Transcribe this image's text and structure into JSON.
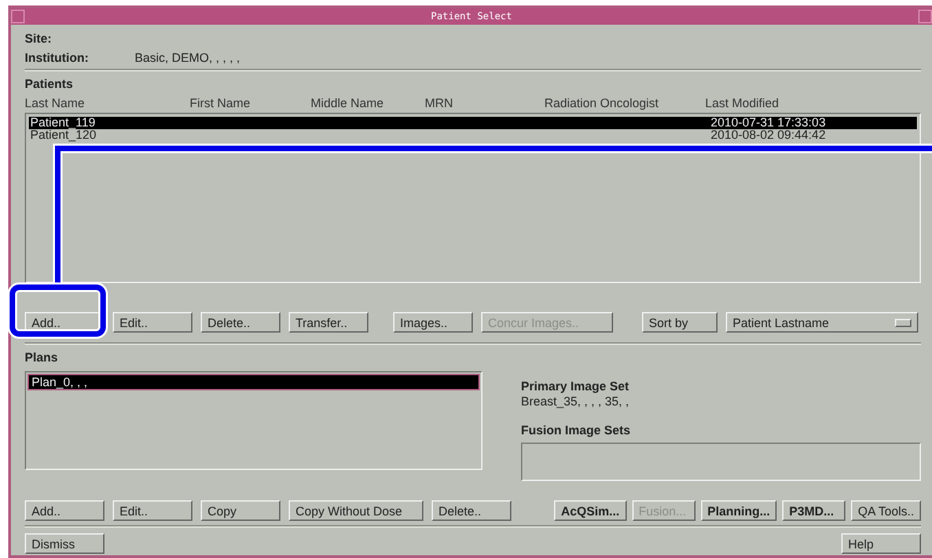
{
  "window": {
    "title": "Patient Select"
  },
  "site": {
    "site_label": "Site:",
    "institution_label": "Institution:",
    "institution_value": "Basic, DEMO, , , , ,"
  },
  "patients": {
    "title": "Patients",
    "columns": [
      "Last Name",
      "First Name",
      "Middle Name",
      "MRN",
      "Radiation Oncologist",
      "Last Modified"
    ],
    "rows": [
      {
        "cells": [
          "Patient_119",
          "",
          "",
          "",
          "",
          "2010-07-31 17:33:03"
        ],
        "selected": true
      },
      {
        "cells": [
          "Patient_120",
          "",
          "",
          "",
          "",
          "2010-08-02 09:44:42"
        ],
        "selected": false
      }
    ],
    "buttons": [
      {
        "label": "Add..",
        "disabled": false
      },
      {
        "label": "Edit..",
        "disabled": false
      },
      {
        "label": "Delete..",
        "disabled": false
      },
      {
        "label": "Transfer..",
        "disabled": false
      },
      {
        "label": "Images..",
        "disabled": false
      },
      {
        "label": "Concur Images..",
        "disabled": true
      }
    ],
    "sort_button": "Sort by",
    "sort_value": "Patient Lastname"
  },
  "plans": {
    "title": "Plans",
    "items": [
      {
        "label": "Plan_0, , ,",
        "selected": true
      }
    ],
    "primary_label": "Primary Image Set",
    "primary_value": "Breast_35, , , , 35, ,",
    "fusion_label": "Fusion Image Sets",
    "left_buttons": [
      {
        "label": "Add..",
        "disabled": false,
        "bold": false
      },
      {
        "label": "Edit..",
        "disabled": false,
        "bold": false
      },
      {
        "label": "Copy",
        "disabled": false,
        "bold": false
      },
      {
        "label": "Copy Without Dose",
        "disabled": false,
        "bold": false
      },
      {
        "label": "Delete..",
        "disabled": false,
        "bold": false
      }
    ],
    "right_buttons": [
      {
        "label": "AcQSim...",
        "disabled": false,
        "bold": true
      },
      {
        "label": "Fusion...",
        "disabled": true,
        "bold": false
      },
      {
        "label": "Planning...",
        "disabled": false,
        "bold": true
      },
      {
        "label": "P3MD...",
        "disabled": false,
        "bold": true
      },
      {
        "label": "QA Tools..",
        "disabled": false,
        "bold": false
      }
    ]
  },
  "footer": {
    "dismiss": "Dismiss",
    "help": "Help"
  }
}
